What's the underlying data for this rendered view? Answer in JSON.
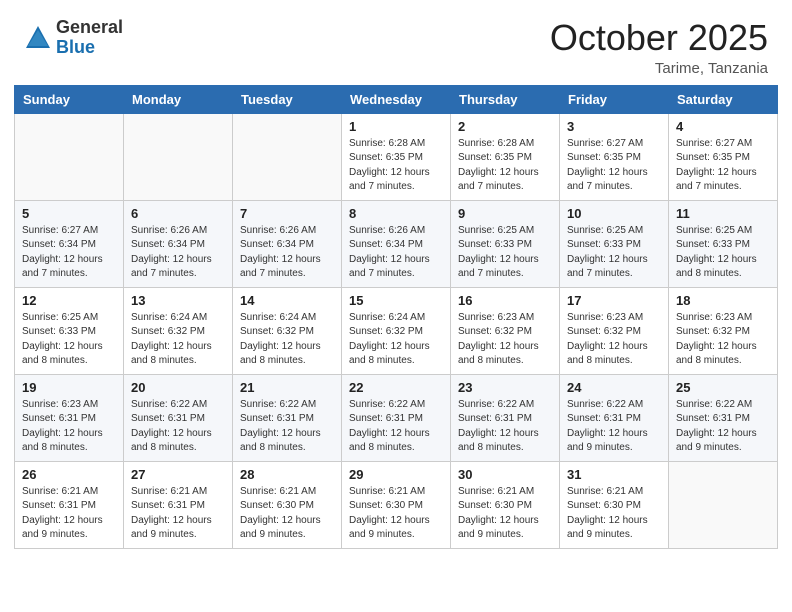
{
  "header": {
    "logo_general": "General",
    "logo_blue": "Blue",
    "month_title": "October 2025",
    "location": "Tarime, Tanzania"
  },
  "days_of_week": [
    "Sunday",
    "Monday",
    "Tuesday",
    "Wednesday",
    "Thursday",
    "Friday",
    "Saturday"
  ],
  "weeks": [
    [
      {
        "day": "",
        "info": ""
      },
      {
        "day": "",
        "info": ""
      },
      {
        "day": "",
        "info": ""
      },
      {
        "day": "1",
        "info": "Sunrise: 6:28 AM\nSunset: 6:35 PM\nDaylight: 12 hours\nand 7 minutes."
      },
      {
        "day": "2",
        "info": "Sunrise: 6:28 AM\nSunset: 6:35 PM\nDaylight: 12 hours\nand 7 minutes."
      },
      {
        "day": "3",
        "info": "Sunrise: 6:27 AM\nSunset: 6:35 PM\nDaylight: 12 hours\nand 7 minutes."
      },
      {
        "day": "4",
        "info": "Sunrise: 6:27 AM\nSunset: 6:35 PM\nDaylight: 12 hours\nand 7 minutes."
      }
    ],
    [
      {
        "day": "5",
        "info": "Sunrise: 6:27 AM\nSunset: 6:34 PM\nDaylight: 12 hours\nand 7 minutes."
      },
      {
        "day": "6",
        "info": "Sunrise: 6:26 AM\nSunset: 6:34 PM\nDaylight: 12 hours\nand 7 minutes."
      },
      {
        "day": "7",
        "info": "Sunrise: 6:26 AM\nSunset: 6:34 PM\nDaylight: 12 hours\nand 7 minutes."
      },
      {
        "day": "8",
        "info": "Sunrise: 6:26 AM\nSunset: 6:34 PM\nDaylight: 12 hours\nand 7 minutes."
      },
      {
        "day": "9",
        "info": "Sunrise: 6:25 AM\nSunset: 6:33 PM\nDaylight: 12 hours\nand 7 minutes."
      },
      {
        "day": "10",
        "info": "Sunrise: 6:25 AM\nSunset: 6:33 PM\nDaylight: 12 hours\nand 7 minutes."
      },
      {
        "day": "11",
        "info": "Sunrise: 6:25 AM\nSunset: 6:33 PM\nDaylight: 12 hours\nand 8 minutes."
      }
    ],
    [
      {
        "day": "12",
        "info": "Sunrise: 6:25 AM\nSunset: 6:33 PM\nDaylight: 12 hours\nand 8 minutes."
      },
      {
        "day": "13",
        "info": "Sunrise: 6:24 AM\nSunset: 6:32 PM\nDaylight: 12 hours\nand 8 minutes."
      },
      {
        "day": "14",
        "info": "Sunrise: 6:24 AM\nSunset: 6:32 PM\nDaylight: 12 hours\nand 8 minutes."
      },
      {
        "day": "15",
        "info": "Sunrise: 6:24 AM\nSunset: 6:32 PM\nDaylight: 12 hours\nand 8 minutes."
      },
      {
        "day": "16",
        "info": "Sunrise: 6:23 AM\nSunset: 6:32 PM\nDaylight: 12 hours\nand 8 minutes."
      },
      {
        "day": "17",
        "info": "Sunrise: 6:23 AM\nSunset: 6:32 PM\nDaylight: 12 hours\nand 8 minutes."
      },
      {
        "day": "18",
        "info": "Sunrise: 6:23 AM\nSunset: 6:32 PM\nDaylight: 12 hours\nand 8 minutes."
      }
    ],
    [
      {
        "day": "19",
        "info": "Sunrise: 6:23 AM\nSunset: 6:31 PM\nDaylight: 12 hours\nand 8 minutes."
      },
      {
        "day": "20",
        "info": "Sunrise: 6:22 AM\nSunset: 6:31 PM\nDaylight: 12 hours\nand 8 minutes."
      },
      {
        "day": "21",
        "info": "Sunrise: 6:22 AM\nSunset: 6:31 PM\nDaylight: 12 hours\nand 8 minutes."
      },
      {
        "day": "22",
        "info": "Sunrise: 6:22 AM\nSunset: 6:31 PM\nDaylight: 12 hours\nand 8 minutes."
      },
      {
        "day": "23",
        "info": "Sunrise: 6:22 AM\nSunset: 6:31 PM\nDaylight: 12 hours\nand 8 minutes."
      },
      {
        "day": "24",
        "info": "Sunrise: 6:22 AM\nSunset: 6:31 PM\nDaylight: 12 hours\nand 9 minutes."
      },
      {
        "day": "25",
        "info": "Sunrise: 6:22 AM\nSunset: 6:31 PM\nDaylight: 12 hours\nand 9 minutes."
      }
    ],
    [
      {
        "day": "26",
        "info": "Sunrise: 6:21 AM\nSunset: 6:31 PM\nDaylight: 12 hours\nand 9 minutes."
      },
      {
        "day": "27",
        "info": "Sunrise: 6:21 AM\nSunset: 6:31 PM\nDaylight: 12 hours\nand 9 minutes."
      },
      {
        "day": "28",
        "info": "Sunrise: 6:21 AM\nSunset: 6:30 PM\nDaylight: 12 hours\nand 9 minutes."
      },
      {
        "day": "29",
        "info": "Sunrise: 6:21 AM\nSunset: 6:30 PM\nDaylight: 12 hours\nand 9 minutes."
      },
      {
        "day": "30",
        "info": "Sunrise: 6:21 AM\nSunset: 6:30 PM\nDaylight: 12 hours\nand 9 minutes."
      },
      {
        "day": "31",
        "info": "Sunrise: 6:21 AM\nSunset: 6:30 PM\nDaylight: 12 hours\nand 9 minutes."
      },
      {
        "day": "",
        "info": ""
      }
    ]
  ]
}
